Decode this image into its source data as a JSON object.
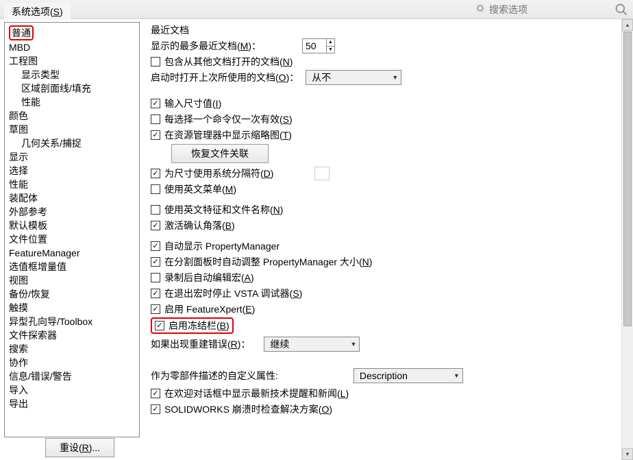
{
  "topbar": {
    "tab_label": "系统选项",
    "tab_mnemonic": "S",
    "search_placeholder": "搜索选项"
  },
  "sidebar": {
    "items": [
      {
        "label": "普通",
        "highlight": true
      },
      {
        "label": "MBD"
      },
      {
        "label": "工程图"
      },
      {
        "label": "显示类型",
        "sub": true
      },
      {
        "label": "区域剖面线/填充",
        "sub": true
      },
      {
        "label": "性能",
        "sub": true
      },
      {
        "label": "颜色"
      },
      {
        "label": "草图"
      },
      {
        "label": "几何关系/捕捉",
        "sub": true
      },
      {
        "label": "显示"
      },
      {
        "label": "选择"
      },
      {
        "label": "性能"
      },
      {
        "label": "装配体"
      },
      {
        "label": "外部参考"
      },
      {
        "label": "默认模板"
      },
      {
        "label": "文件位置"
      },
      {
        "label": "FeatureManager"
      },
      {
        "label": "选值框增量值"
      },
      {
        "label": "视图"
      },
      {
        "label": "备份/恢复"
      },
      {
        "label": "触摸"
      },
      {
        "label": "异型孔向导/Toolbox"
      },
      {
        "label": "文件探索器"
      },
      {
        "label": "搜索"
      },
      {
        "label": "协作"
      },
      {
        "label": "信息/错误/警告"
      },
      {
        "label": "导入"
      },
      {
        "label": "导出"
      }
    ]
  },
  "content": {
    "recent_docs_title": "最近文档",
    "max_recent_label": "显示的最多最近文档",
    "max_recent_mnemonic": "M",
    "max_recent_value": "50",
    "include_other_label": "包含从其他文档打开的文档",
    "include_other_mnemonic": "N",
    "include_other_checked": false,
    "open_last_label": "启动时打开上次所使用的文档",
    "open_last_mnemonic": "O",
    "open_last_value": "从不",
    "cb_input_dim": {
      "label": "输入尺寸值",
      "mn": "I",
      "checked": true
    },
    "cb_single_cmd": {
      "label": "每选择一个命令仅一次有效",
      "mn": "S",
      "checked": false
    },
    "cb_thumb": {
      "label": "在资源管理器中显示缩略图",
      "mn": "T",
      "checked": true
    },
    "restore_assoc_btn": "恢复文件关联",
    "cb_sys_sep": {
      "label": "为尺寸使用系统分隔符",
      "mn": "D",
      "checked": true
    },
    "cb_eng_menu": {
      "label": "使用英文菜单",
      "mn": "M",
      "checked": false
    },
    "cb_eng_feat": {
      "label": "使用英文特征和文件名称",
      "mn": "N",
      "checked": false
    },
    "cb_confirm_corner": {
      "label": "激活确认角落",
      "mn": "B",
      "checked": true
    },
    "cb_auto_pm": {
      "label": "自动显示 PropertyManager",
      "mn": "",
      "checked": true
    },
    "cb_auto_resize_pm": {
      "label": "在分割面板时自动调整 PropertyManager 大小",
      "mn": "N",
      "checked": true
    },
    "cb_edit_macro": {
      "label": "录制后自动编辑宏",
      "mn": "A",
      "checked": false
    },
    "cb_stop_vsta": {
      "label": "在退出宏时停止 VSTA 调试器",
      "mn": "S",
      "checked": true
    },
    "cb_featurexpert": {
      "label": "启用 FeatureXpert",
      "mn": "E",
      "checked": true
    },
    "cb_freeze_bar": {
      "label": "启用冻结栏",
      "mn": "B",
      "checked": true
    },
    "rebuild_err_label": "如果出现重建错误",
    "rebuild_err_mnemonic": "R",
    "rebuild_err_value": "继续",
    "custom_prop_label": "作为零部件描述的自定义属性:",
    "custom_prop_value": "Description",
    "cb_welcome_news": {
      "label": "在欢迎对话框中显示最新技术提醒和新闻",
      "mn": "L",
      "checked": true
    },
    "cb_sw_crash": {
      "label": "SOLIDWORKS 崩溃时检查解决方案",
      "mn": "O",
      "checked": true
    }
  },
  "reset_btn": "重设",
  "reset_mnemonic": "R"
}
